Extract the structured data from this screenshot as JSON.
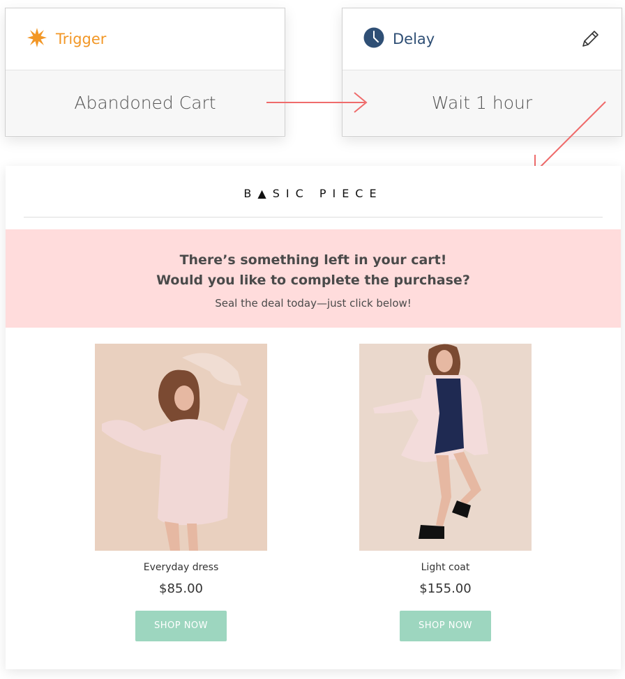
{
  "trigger_card": {
    "title": "Trigger",
    "value": "Abandoned Cart",
    "icon": "starburst-icon",
    "accent": "#f29726"
  },
  "delay_card": {
    "title": "Delay",
    "value": "Wait 1 hour",
    "icon": "clock-icon",
    "edit_icon": "pencil-icon",
    "accent": "#2f4f75"
  },
  "arrow_color": "#ef6b6b",
  "email": {
    "brand": "B▲SIC PIECE",
    "banner": {
      "line1": "There’s something left in your cart!",
      "line2": "Would you like to complete the purchase?",
      "sub": "Seal the deal today—just click below!",
      "bg": "#ffdcdc"
    },
    "products": [
      {
        "name": "Everyday dress",
        "price": "$85.00",
        "button": "SHOP NOW"
      },
      {
        "name": "Light coat",
        "price": "$155.00",
        "button": "SHOP NOW"
      }
    ],
    "button_color": "#9dd6bf"
  }
}
